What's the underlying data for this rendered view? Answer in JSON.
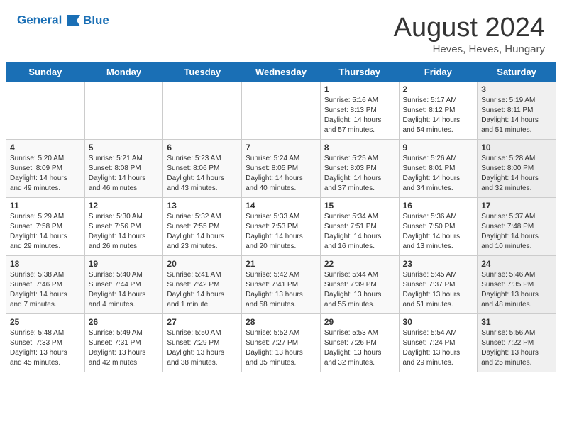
{
  "header": {
    "logo_line1": "General",
    "logo_line2": "Blue",
    "month_year": "August 2024",
    "location": "Heves, Heves, Hungary"
  },
  "weekdays": [
    "Sunday",
    "Monday",
    "Tuesday",
    "Wednesday",
    "Thursday",
    "Friday",
    "Saturday"
  ],
  "weeks": [
    [
      {
        "day": "",
        "info": ""
      },
      {
        "day": "",
        "info": ""
      },
      {
        "day": "",
        "info": ""
      },
      {
        "day": "",
        "info": ""
      },
      {
        "day": "1",
        "info": "Sunrise: 5:16 AM\nSunset: 8:13 PM\nDaylight: 14 hours\nand 57 minutes."
      },
      {
        "day": "2",
        "info": "Sunrise: 5:17 AM\nSunset: 8:12 PM\nDaylight: 14 hours\nand 54 minutes."
      },
      {
        "day": "3",
        "info": "Sunrise: 5:19 AM\nSunset: 8:11 PM\nDaylight: 14 hours\nand 51 minutes."
      }
    ],
    [
      {
        "day": "4",
        "info": "Sunrise: 5:20 AM\nSunset: 8:09 PM\nDaylight: 14 hours\nand 49 minutes."
      },
      {
        "day": "5",
        "info": "Sunrise: 5:21 AM\nSunset: 8:08 PM\nDaylight: 14 hours\nand 46 minutes."
      },
      {
        "day": "6",
        "info": "Sunrise: 5:23 AM\nSunset: 8:06 PM\nDaylight: 14 hours\nand 43 minutes."
      },
      {
        "day": "7",
        "info": "Sunrise: 5:24 AM\nSunset: 8:05 PM\nDaylight: 14 hours\nand 40 minutes."
      },
      {
        "day": "8",
        "info": "Sunrise: 5:25 AM\nSunset: 8:03 PM\nDaylight: 14 hours\nand 37 minutes."
      },
      {
        "day": "9",
        "info": "Sunrise: 5:26 AM\nSunset: 8:01 PM\nDaylight: 14 hours\nand 34 minutes."
      },
      {
        "day": "10",
        "info": "Sunrise: 5:28 AM\nSunset: 8:00 PM\nDaylight: 14 hours\nand 32 minutes."
      }
    ],
    [
      {
        "day": "11",
        "info": "Sunrise: 5:29 AM\nSunset: 7:58 PM\nDaylight: 14 hours\nand 29 minutes."
      },
      {
        "day": "12",
        "info": "Sunrise: 5:30 AM\nSunset: 7:56 PM\nDaylight: 14 hours\nand 26 minutes."
      },
      {
        "day": "13",
        "info": "Sunrise: 5:32 AM\nSunset: 7:55 PM\nDaylight: 14 hours\nand 23 minutes."
      },
      {
        "day": "14",
        "info": "Sunrise: 5:33 AM\nSunset: 7:53 PM\nDaylight: 14 hours\nand 20 minutes."
      },
      {
        "day": "15",
        "info": "Sunrise: 5:34 AM\nSunset: 7:51 PM\nDaylight: 14 hours\nand 16 minutes."
      },
      {
        "day": "16",
        "info": "Sunrise: 5:36 AM\nSunset: 7:50 PM\nDaylight: 14 hours\nand 13 minutes."
      },
      {
        "day": "17",
        "info": "Sunrise: 5:37 AM\nSunset: 7:48 PM\nDaylight: 14 hours\nand 10 minutes."
      }
    ],
    [
      {
        "day": "18",
        "info": "Sunrise: 5:38 AM\nSunset: 7:46 PM\nDaylight: 14 hours\nand 7 minutes."
      },
      {
        "day": "19",
        "info": "Sunrise: 5:40 AM\nSunset: 7:44 PM\nDaylight: 14 hours\nand 4 minutes."
      },
      {
        "day": "20",
        "info": "Sunrise: 5:41 AM\nSunset: 7:42 PM\nDaylight: 14 hours\nand 1 minute."
      },
      {
        "day": "21",
        "info": "Sunrise: 5:42 AM\nSunset: 7:41 PM\nDaylight: 13 hours\nand 58 minutes."
      },
      {
        "day": "22",
        "info": "Sunrise: 5:44 AM\nSunset: 7:39 PM\nDaylight: 13 hours\nand 55 minutes."
      },
      {
        "day": "23",
        "info": "Sunrise: 5:45 AM\nSunset: 7:37 PM\nDaylight: 13 hours\nand 51 minutes."
      },
      {
        "day": "24",
        "info": "Sunrise: 5:46 AM\nSunset: 7:35 PM\nDaylight: 13 hours\nand 48 minutes."
      }
    ],
    [
      {
        "day": "25",
        "info": "Sunrise: 5:48 AM\nSunset: 7:33 PM\nDaylight: 13 hours\nand 45 minutes."
      },
      {
        "day": "26",
        "info": "Sunrise: 5:49 AM\nSunset: 7:31 PM\nDaylight: 13 hours\nand 42 minutes."
      },
      {
        "day": "27",
        "info": "Sunrise: 5:50 AM\nSunset: 7:29 PM\nDaylight: 13 hours\nand 38 minutes."
      },
      {
        "day": "28",
        "info": "Sunrise: 5:52 AM\nSunset: 7:27 PM\nDaylight: 13 hours\nand 35 minutes."
      },
      {
        "day": "29",
        "info": "Sunrise: 5:53 AM\nSunset: 7:26 PM\nDaylight: 13 hours\nand 32 minutes."
      },
      {
        "day": "30",
        "info": "Sunrise: 5:54 AM\nSunset: 7:24 PM\nDaylight: 13 hours\nand 29 minutes."
      },
      {
        "day": "31",
        "info": "Sunrise: 5:56 AM\nSunset: 7:22 PM\nDaylight: 13 hours\nand 25 minutes."
      }
    ]
  ]
}
